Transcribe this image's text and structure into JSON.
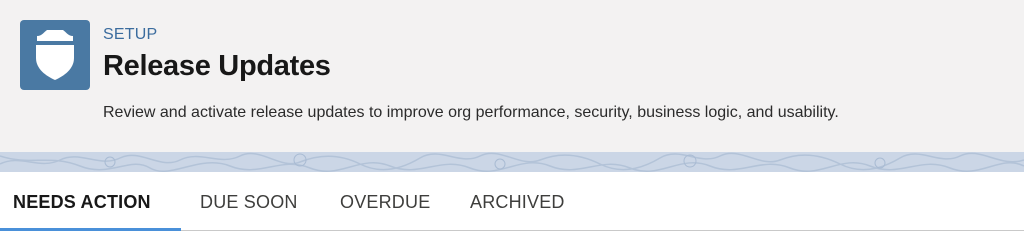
{
  "header": {
    "icon": "shield-icon",
    "eyebrow": "SETUP",
    "title": "Release Updates",
    "description": "Review and activate release updates to improve org performance, security, business logic, and usability."
  },
  "tabs": [
    {
      "label": "NEEDS ACTION",
      "active": true
    },
    {
      "label": "DUE SOON",
      "active": false
    },
    {
      "label": "OVERDUE",
      "active": false
    },
    {
      "label": "ARCHIVED",
      "active": false
    }
  ],
  "colors": {
    "icon_tile": "#4a79a3",
    "eyebrow": "#3b6c9e",
    "active_tab_underline": "#4a90d9",
    "band": "#cbd6e6"
  }
}
